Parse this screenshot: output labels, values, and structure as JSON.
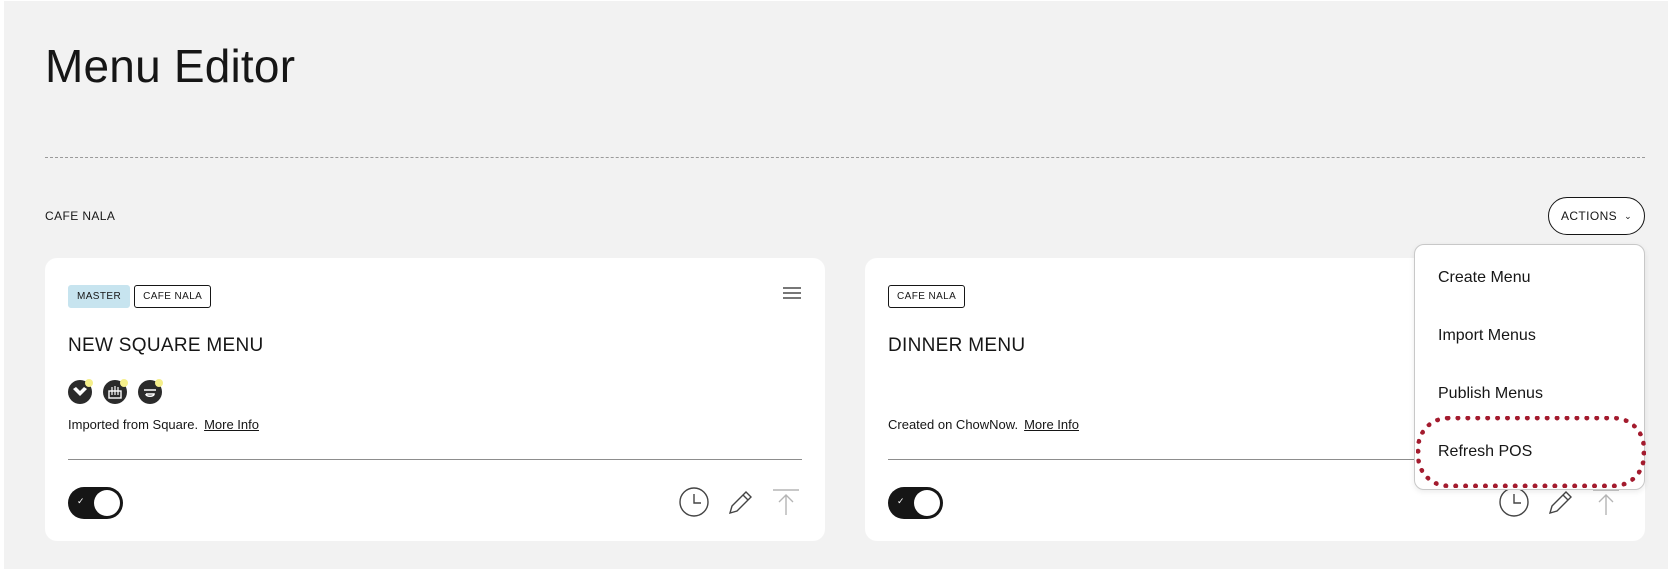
{
  "page": {
    "title": "Menu Editor",
    "restaurant": "CAFE NALA"
  },
  "actions": {
    "label": "ACTIONS",
    "items": [
      "Create Menu",
      "Import Menus",
      "Publish Menus",
      "Refresh POS"
    ],
    "highlighted_item": "Refresh POS"
  },
  "cards": [
    {
      "tags": [
        "MASTER",
        "CAFE NALA"
      ],
      "name": "NEW SQUARE MENU",
      "source_text": "Imported from Square.",
      "more_info": "More Info",
      "pos_icons": [
        "square-pos-icon",
        "restaurant-pos-icon",
        "delivery-pos-icon"
      ],
      "enabled": true
    },
    {
      "tags": [
        "CAFE NALA"
      ],
      "name": "DINNER MENU",
      "source_text": "Created on ChowNow.",
      "more_info": "More Info",
      "enabled": true
    }
  ],
  "colors": {
    "background": "#f2f2f2",
    "master_tag": "#c7e4ef",
    "highlight": "#a31b2e",
    "text": "#161616"
  }
}
